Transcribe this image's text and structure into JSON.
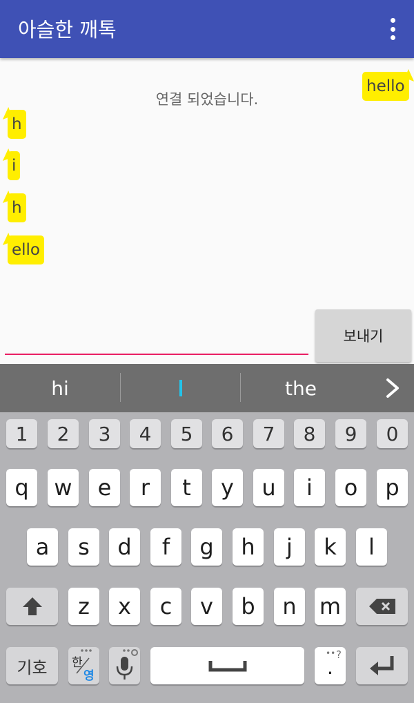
{
  "appbar": {
    "title": "아슬한 깨톡",
    "overflow_icon": "more-vert-icon"
  },
  "chat": {
    "status": "연결 되었습니다.",
    "outgoing": [
      {
        "text": "hello"
      }
    ],
    "incoming": [
      {
        "text": "h"
      },
      {
        "text": "i"
      },
      {
        "text": "h"
      },
      {
        "text": "ello"
      }
    ],
    "bubble_color": "#ffee00"
  },
  "composer": {
    "input_value": "",
    "send_label": "보내기"
  },
  "suggestions": {
    "left": "hi",
    "right": "the"
  },
  "keyboard": {
    "numbers": [
      "1",
      "2",
      "3",
      "4",
      "5",
      "6",
      "7",
      "8",
      "9",
      "0"
    ],
    "row1": [
      "q",
      "w",
      "e",
      "r",
      "t",
      "y",
      "u",
      "i",
      "o",
      "p"
    ],
    "row2": [
      "a",
      "s",
      "d",
      "f",
      "g",
      "h",
      "j",
      "k",
      "l"
    ],
    "row3": [
      "z",
      "x",
      "c",
      "v",
      "b",
      "n",
      "m"
    ],
    "symbols_label": "기호",
    "lang_top": "한",
    "lang_bottom": "영",
    "period_label": ".",
    "period_hint": "?"
  },
  "colors": {
    "appbar": "#3f51b5",
    "accent": "#e91e63",
    "cursor": "#23c3ea"
  }
}
